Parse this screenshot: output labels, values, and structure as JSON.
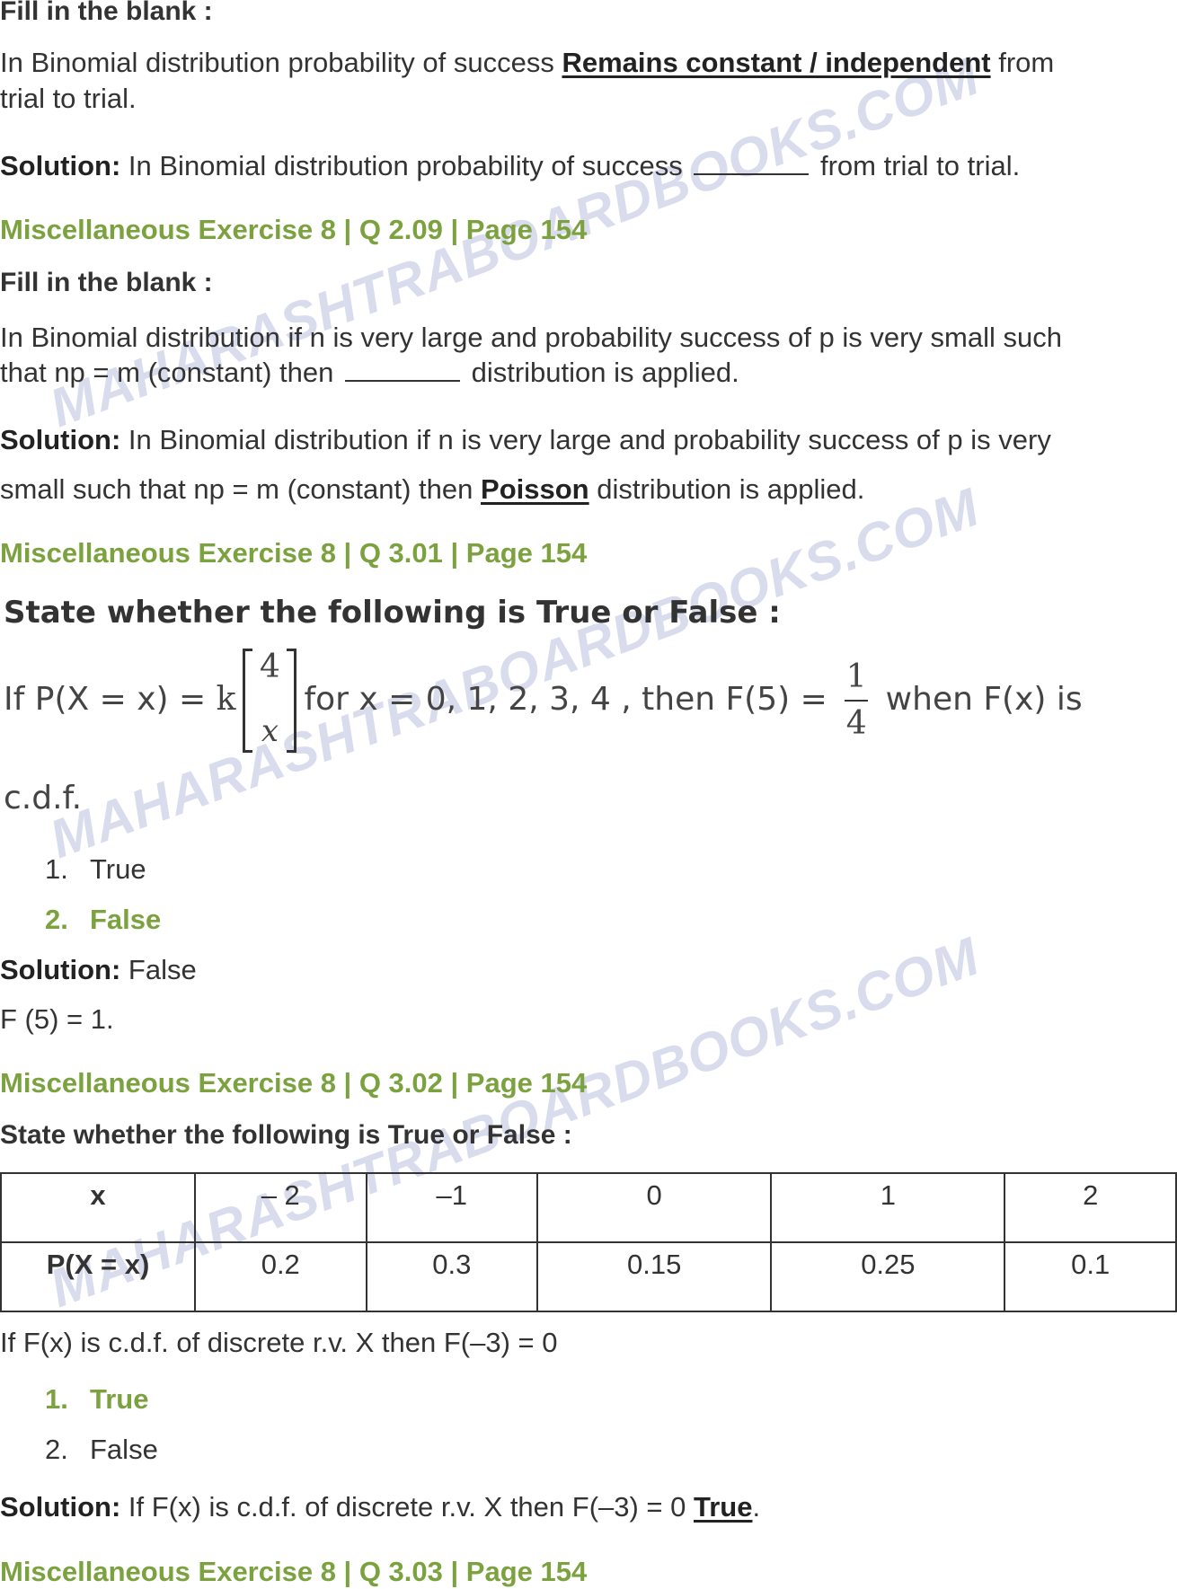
{
  "watermark": "MAHARASHTRABOARDBOOKS.COM",
  "colors": {
    "accent_green": "#7ba23f",
    "text": "#333333",
    "watermark": "#aab2d7"
  },
  "q208": {
    "label": "Fill in the blank :",
    "question_pre": "In Binomial distribution probability of success ",
    "question_answer": "Remains constant / independent",
    "question_post_line1": " from",
    "question_line2": "trial to trial.",
    "solution_label": "Solution:",
    "solution_pre": " In Binomial distribution probability of success ",
    "solution_post": " from trial to trial."
  },
  "q209": {
    "header": "Miscellaneous Exercise 8 | Q 2.09 | Page 154",
    "label": "Fill in the blank :",
    "question_line1": "In Binomial distribution if n is very large and probability success of p is very small such",
    "question_line2_pre": "that np = m (constant) then ",
    "question_line2_post": " distribution is applied.",
    "solution_label": "Solution:",
    "solution_line1": " In Binomial distribution if n is very large and probability success of p is very",
    "solution_line2_pre": "small such that np = m (constant) then ",
    "solution_answer": "Poisson",
    "solution_line2_post": " distribution is applied."
  },
  "q301": {
    "header": "Miscellaneous Exercise 8 | Q 3.01 | Page 154",
    "statement": "State whether the following is True or False :",
    "math_pre": "If P(X = x) = ",
    "math_k": "k",
    "binom_top": "4",
    "binom_bottom": "x",
    "math_mid": "for x = 0, 1, 2, 3, 4 , then F(5) = ",
    "frac_num": "1",
    "frac_den": "4",
    "math_post": " when F(x) is",
    "math_line2": "c.d.f.",
    "options": [
      {
        "num": "1.",
        "label": "True",
        "correct": false
      },
      {
        "num": "2.",
        "label": "False",
        "correct": true
      }
    ],
    "solution_label": "Solution:",
    "solution_text": " False",
    "solution_detail": "F (5) = 1."
  },
  "q302": {
    "header": "Miscellaneous Exercise 8 | Q 3.02 | Page 154",
    "statement": "State whether the following is True or False :",
    "table": {
      "row_headers": [
        "x",
        "P(X = x)"
      ],
      "x_values": [
        "– 2",
        "–1",
        "0",
        "1",
        "2"
      ],
      "p_values": [
        "0.2",
        "0.3",
        "0.15",
        "0.25",
        "0.1"
      ]
    },
    "question": "If F(x) is c.d.f. of discrete r.v. X then F(–3) = 0",
    "options": [
      {
        "num": "1.",
        "label": "True",
        "correct": true
      },
      {
        "num": "2.",
        "label": "False",
        "correct": false
      }
    ],
    "solution_label": "Solution:",
    "solution_text": " If F(x) is c.d.f. of discrete r.v. X then F(–3) = 0 ",
    "solution_answer": "True",
    "solution_end": "."
  },
  "q303": {
    "header": "Miscellaneous Exercise 8 | Q 3.03 | Page 154"
  }
}
